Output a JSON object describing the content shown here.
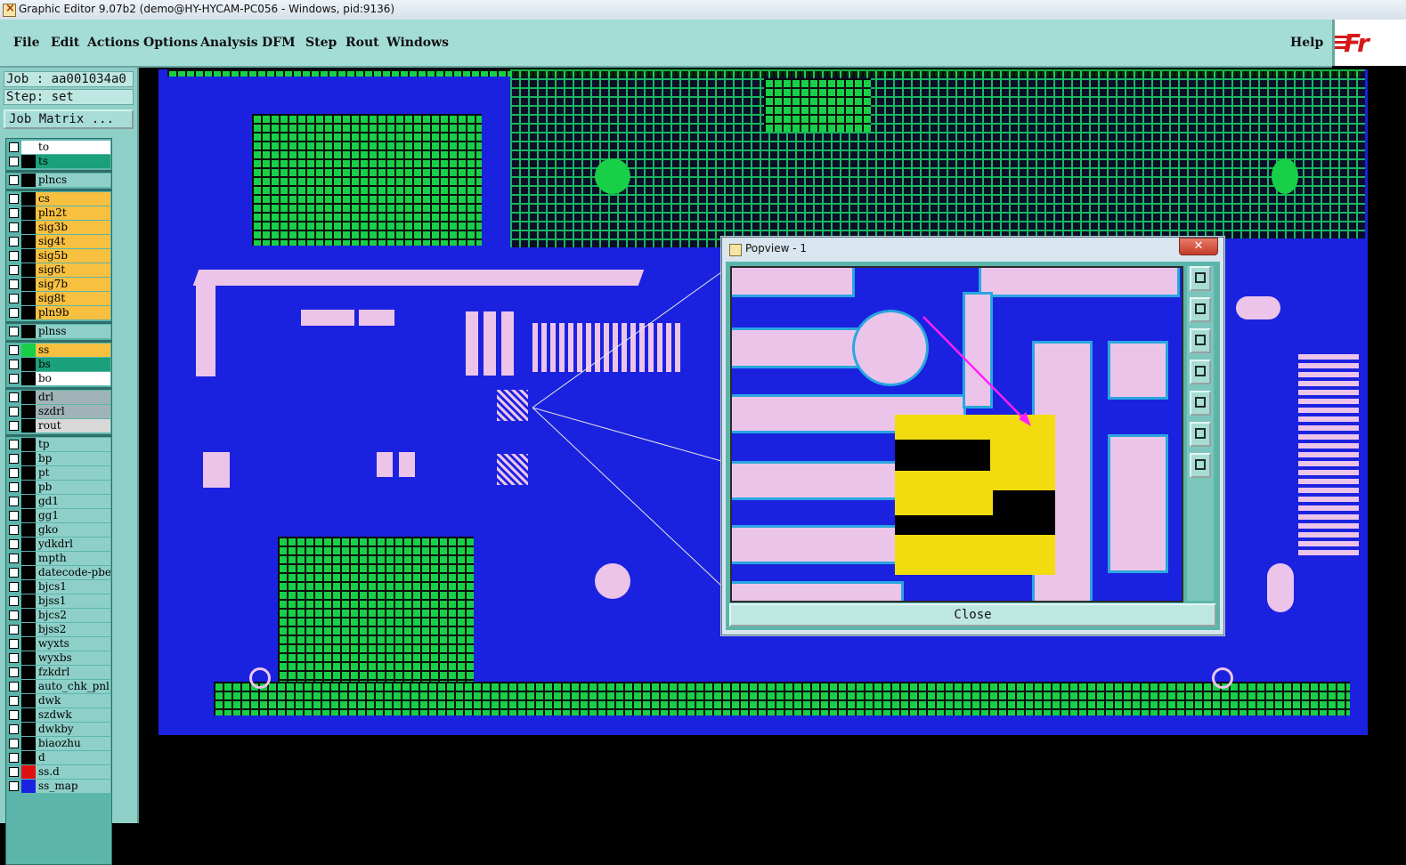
{
  "window": {
    "title": "Graphic Editor 9.07b2 (demo@HY-HYCAM-PC056 - Windows, pid:9136)"
  },
  "menu": {
    "file": "File",
    "edit": "Edit",
    "actions": "Actions",
    "options": "Options",
    "analysis": "Analysis",
    "dfm": "DFM",
    "step": "Step",
    "rout": "Rout",
    "windows": "Windows",
    "help": "Help"
  },
  "logo": {
    "text": "Fr"
  },
  "panel": {
    "job": "Job : aa001034a0",
    "step": "Step: set",
    "job_matrix": "Job Matrix ..."
  },
  "layers": [
    {
      "name": "to",
      "color": "#ffffff",
      "bg": "#ffffff"
    },
    {
      "name": "ts",
      "color": "#000000",
      "bg": "#1aa07a"
    },
    {
      "name": "plncs",
      "color": "#000000",
      "bg": "#8ed0c8"
    },
    {
      "name": "cs",
      "color": "#000000",
      "bg": "#f7c040"
    },
    {
      "name": "pln2t",
      "color": "#000000",
      "bg": "#f7c040"
    },
    {
      "name": "sig3b",
      "color": "#000000",
      "bg": "#f7c040"
    },
    {
      "name": "sig4t",
      "color": "#000000",
      "bg": "#f7c040"
    },
    {
      "name": "sig5b",
      "color": "#000000",
      "bg": "#f7c040"
    },
    {
      "name": "sig6t",
      "color": "#000000",
      "bg": "#f7c040"
    },
    {
      "name": "sig7b",
      "color": "#000000",
      "bg": "#f7c040"
    },
    {
      "name": "sig8t",
      "color": "#000000",
      "bg": "#f7c040"
    },
    {
      "name": "pln9b",
      "color": "#000000",
      "bg": "#f7c040"
    },
    {
      "name": "plnss",
      "color": "#000000",
      "bg": "#8ed0c8"
    },
    {
      "name": "ss",
      "color": "#18d048",
      "bg": "#f7c040"
    },
    {
      "name": "bs",
      "color": "#000000",
      "bg": "#1aa07a"
    },
    {
      "name": "bo",
      "color": "#000000",
      "bg": "#ffffff"
    },
    {
      "name": "drl",
      "color": "#000000",
      "bg": "#a0b4b8"
    },
    {
      "name": "szdrl",
      "color": "#000000",
      "bg": "#a0b4b8"
    },
    {
      "name": "rout",
      "color": "#000000",
      "bg": "#d8d8d8"
    },
    {
      "name": "tp",
      "color": "#000000",
      "bg": "#8ed0c8"
    },
    {
      "name": "bp",
      "color": "#000000",
      "bg": "#8ed0c8"
    },
    {
      "name": "pt",
      "color": "#000000",
      "bg": "#8ed0c8"
    },
    {
      "name": "pb",
      "color": "#000000",
      "bg": "#8ed0c8"
    },
    {
      "name": "gd1",
      "color": "#000000",
      "bg": "#8ed0c8"
    },
    {
      "name": "gg1",
      "color": "#000000",
      "bg": "#8ed0c8"
    },
    {
      "name": "gko",
      "color": "#000000",
      "bg": "#8ed0c8"
    },
    {
      "name": "ydkdrl",
      "color": "#000000",
      "bg": "#8ed0c8"
    },
    {
      "name": "mpth",
      "color": "#000000",
      "bg": "#8ed0c8"
    },
    {
      "name": "datecode-pbe",
      "color": "#000000",
      "bg": "#8ed0c8"
    },
    {
      "name": "bjcs1",
      "color": "#000000",
      "bg": "#8ed0c8"
    },
    {
      "name": "bjss1",
      "color": "#000000",
      "bg": "#8ed0c8"
    },
    {
      "name": "bjcs2",
      "color": "#000000",
      "bg": "#8ed0c8"
    },
    {
      "name": "bjss2",
      "color": "#000000",
      "bg": "#8ed0c8"
    },
    {
      "name": "wyxts",
      "color": "#000000",
      "bg": "#8ed0c8"
    },
    {
      "name": "wyxbs",
      "color": "#000000",
      "bg": "#8ed0c8"
    },
    {
      "name": "fzkdrl",
      "color": "#000000",
      "bg": "#8ed0c8"
    },
    {
      "name": "auto_chk_pnl",
      "color": "#000000",
      "bg": "#8ed0c8"
    },
    {
      "name": "dwk",
      "color": "#000000",
      "bg": "#8ed0c8"
    },
    {
      "name": "szdwk",
      "color": "#000000",
      "bg": "#8ed0c8"
    },
    {
      "name": "dwkby",
      "color": "#000000",
      "bg": "#8ed0c8"
    },
    {
      "name": "biaozhu",
      "color": "#000000",
      "bg": "#8ed0c8"
    },
    {
      "name": "d",
      "color": "#000000",
      "bg": "#8ed0c8"
    },
    {
      "name": "ss.d",
      "color": "#e01010",
      "bg": "#8ed0c8"
    },
    {
      "name": "ss_map",
      "color": "#1a22e0",
      "bg": "#8ed0c8"
    }
  ],
  "popview": {
    "title": "Popview - 1",
    "close_x": "✕",
    "close_label": "Close"
  },
  "colors": {
    "board": "#1a22e0",
    "copper": "#18d048",
    "pad": "#ecc4ea",
    "highlight": "#f2dc10",
    "arrow": "#ff20ff",
    "panel": "#8ed0c8"
  }
}
